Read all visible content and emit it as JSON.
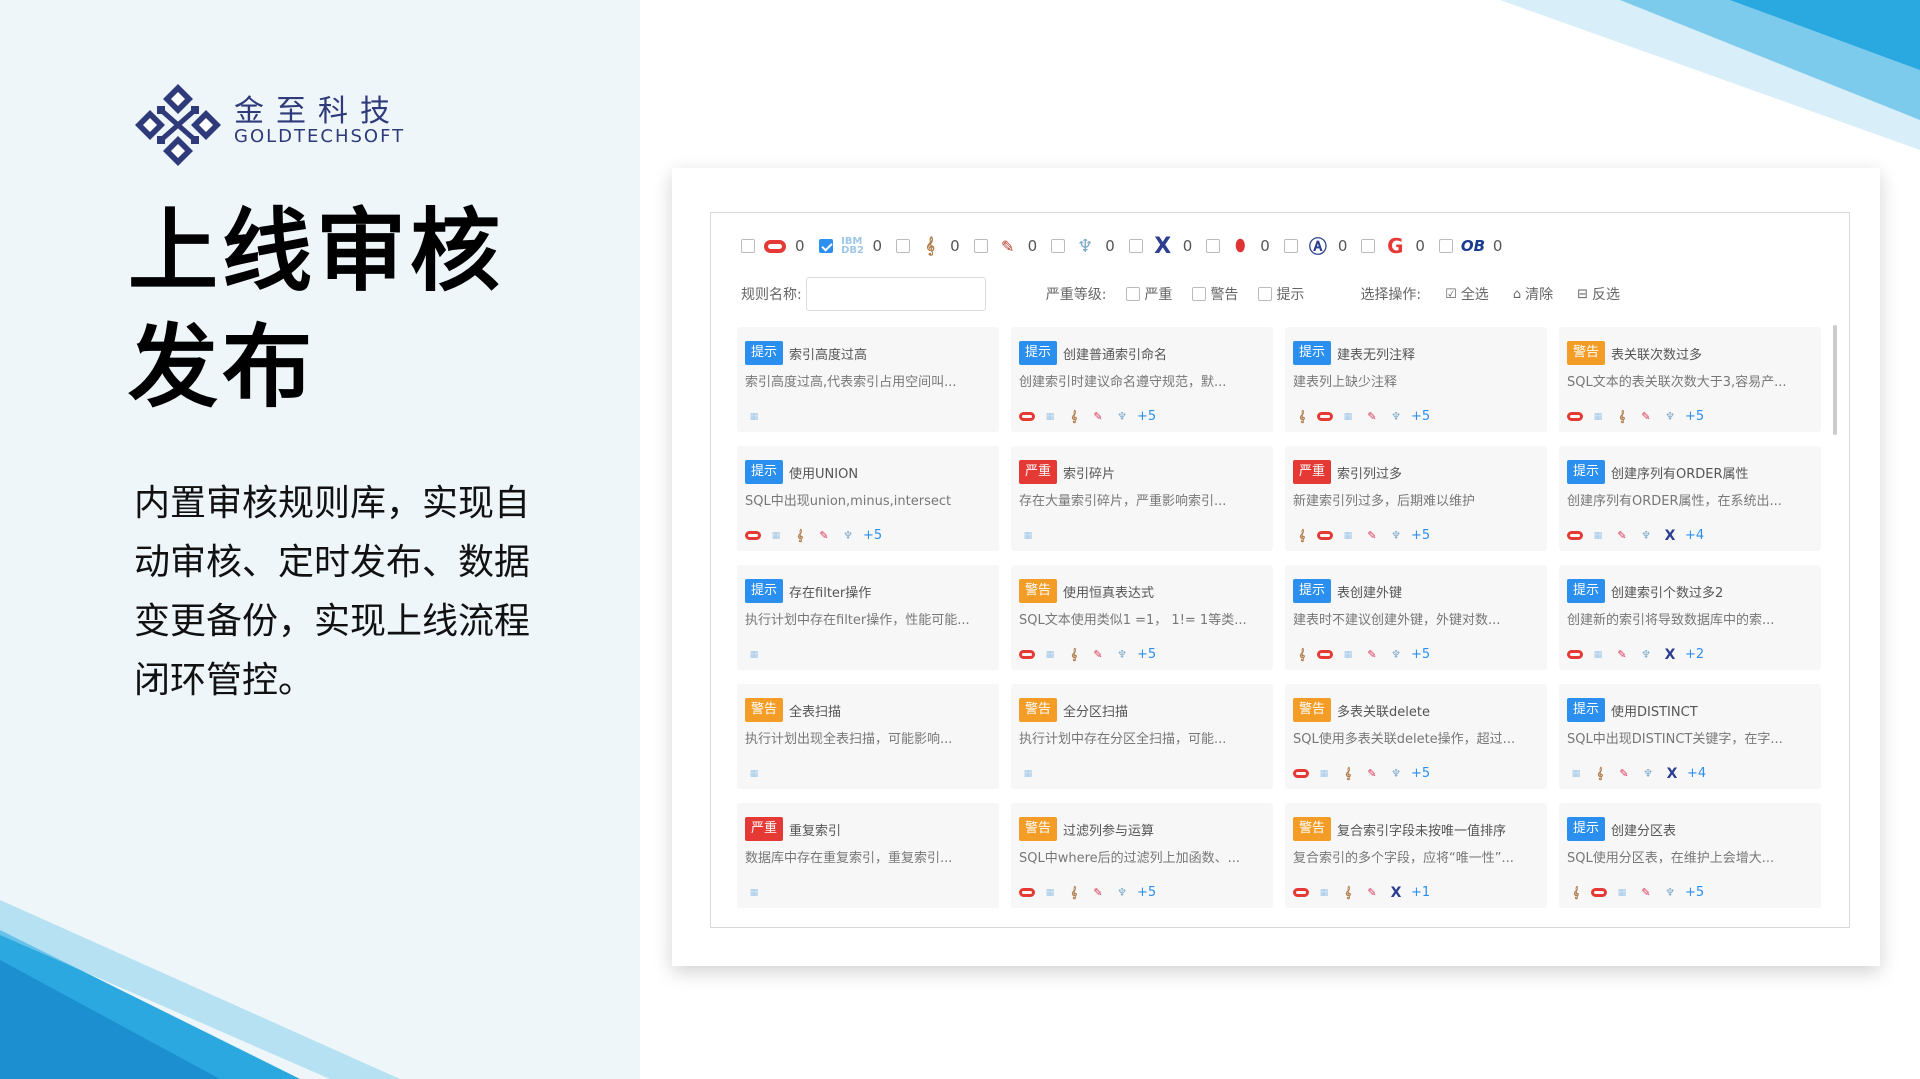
{
  "brand": {
    "name_cn": "金至科技",
    "name_en": "GOLDTECHSOFT",
    "color": "#2f3a7a"
  },
  "title_lines": [
    "上线审核",
    "发布"
  ],
  "description": "内置审核规则库，实现自动审核、定时发布、数据变更备份，实现上线流程闭环管控。",
  "accent_colors": {
    "blue": "#2b8ff0",
    "orange": "#f39c26",
    "red": "#e53935",
    "deco": "#29a9e0"
  },
  "db_filters": [
    {
      "icon": "oracle-icon",
      "count": "0",
      "checked": false
    },
    {
      "icon": "db2-icon",
      "count": "0",
      "checked": true
    },
    {
      "icon": "mysql-icon",
      "count": "0",
      "checked": false
    },
    {
      "icon": "mariadb-icon",
      "count": "0",
      "checked": false
    },
    {
      "icon": "postgresql-icon",
      "count": "0",
      "checked": false
    },
    {
      "icon": "x-db-icon",
      "count": "0",
      "checked": false
    },
    {
      "icon": "redis-icon",
      "count": "0",
      "checked": false
    },
    {
      "icon": "arrow-db-icon",
      "count": "0",
      "checked": false
    },
    {
      "icon": "g-db-icon",
      "count": "0",
      "checked": false
    },
    {
      "icon": "oceanbase-icon",
      "count": "0",
      "checked": false
    }
  ],
  "filters": {
    "rule_name_label": "规则名称:",
    "severity_label": "严重等级:",
    "severity_options": [
      "严重",
      "警告",
      "提示"
    ],
    "ops_label": "选择操作:",
    "ops": [
      {
        "icon": "check-all-icon",
        "label": "全选"
      },
      {
        "icon": "clear-icon",
        "label": "清除"
      },
      {
        "icon": "invert-icon",
        "label": "反选"
      }
    ]
  },
  "rules": [
    {
      "level": "提示",
      "kind": "tip",
      "name": "索引高度过高",
      "desc": "索引高度过高,代表索引占用空间叫...",
      "dbs": [
        "db2"
      ],
      "extra": ""
    },
    {
      "level": "提示",
      "kind": "tip",
      "name": "创建普通索引命名",
      "desc": "创建索引时建议命名遵守规范，默...",
      "dbs": [
        "oracle",
        "db2",
        "mysql",
        "mongo",
        "pg"
      ],
      "extra": "+5"
    },
    {
      "level": "提示",
      "kind": "tip",
      "name": "建表无列注释",
      "desc": "建表列上缺少注释",
      "dbs": [
        "mysql",
        "oracle",
        "db2",
        "mongo",
        "pg"
      ],
      "extra": "+5"
    },
    {
      "level": "警告",
      "kind": "warn",
      "name": "表关联次数过多",
      "desc": "SQL文本的表关联次数大于3,容易产...",
      "dbs": [
        "oracle",
        "db2",
        "mysql",
        "mongo",
        "pg"
      ],
      "extra": "+5"
    },
    {
      "level": "提示",
      "kind": "tip",
      "name": "使用UNION",
      "desc": "SQL中出现union,minus,intersect",
      "dbs": [
        "oracle",
        "db2",
        "mysql",
        "mongo",
        "pg"
      ],
      "extra": "+5"
    },
    {
      "level": "严重",
      "kind": "severe",
      "name": "索引碎片",
      "desc": "存在大量索引碎片，严重影响索引...",
      "dbs": [
        "db2"
      ],
      "extra": ""
    },
    {
      "level": "严重",
      "kind": "severe",
      "name": "索引列过多",
      "desc": "新建索引列过多，后期难以维护",
      "dbs": [
        "mysql",
        "oracle",
        "db2",
        "mongo",
        "pg"
      ],
      "extra": "+5"
    },
    {
      "level": "提示",
      "kind": "tip",
      "name": "创建序列有ORDER属性",
      "desc": "创建序列有ORDER属性，在系统出...",
      "dbs": [
        "oracle",
        "db2",
        "mongo",
        "pg",
        "x"
      ],
      "extra": "+4"
    },
    {
      "level": "提示",
      "kind": "tip",
      "name": "存在filter操作",
      "desc": "执行计划中存在filter操作，性能可能...",
      "dbs": [
        "db2"
      ],
      "extra": ""
    },
    {
      "level": "警告",
      "kind": "warn",
      "name": "使用恒真表达式",
      "desc": "SQL文本使用类似1 =1， 1!= 1等类...",
      "dbs": [
        "oracle",
        "db2",
        "mysql",
        "mongo",
        "pg"
      ],
      "extra": "+5"
    },
    {
      "level": "提示",
      "kind": "tip",
      "name": "表创建外键",
      "desc": "建表时不建议创建外键，外键对数...",
      "dbs": [
        "mysql",
        "oracle",
        "db2",
        "mongo",
        "pg"
      ],
      "extra": "+5"
    },
    {
      "level": "提示",
      "kind": "tip",
      "name": "创建索引个数过多2",
      "desc": "创建新的索引将导致数据库中的索...",
      "dbs": [
        "oracle",
        "db2",
        "mongo",
        "pg",
        "x"
      ],
      "extra": "+2"
    },
    {
      "level": "警告",
      "kind": "warn",
      "name": "全表扫描",
      "desc": "执行计划出现全表扫描，可能影响...",
      "dbs": [
        "db2"
      ],
      "extra": ""
    },
    {
      "level": "警告",
      "kind": "warn",
      "name": "全分区扫描",
      "desc": "执行计划中存在分区全扫描，可能...",
      "dbs": [
        "db2"
      ],
      "extra": ""
    },
    {
      "level": "警告",
      "kind": "warn",
      "name": "多表关联delete",
      "desc": "SQL使用多表关联delete操作，超过...",
      "dbs": [
        "oracle",
        "db2",
        "mysql",
        "mongo",
        "pg"
      ],
      "extra": "+5"
    },
    {
      "level": "提示",
      "kind": "tip",
      "name": "使用DISTINCT",
      "desc": "SQL中出现DISTINCT关键字，在字...",
      "dbs": [
        "db2",
        "mysql",
        "mongo",
        "pg",
        "x"
      ],
      "extra": "+4"
    },
    {
      "level": "严重",
      "kind": "severe",
      "name": "重复索引",
      "desc": "数据库中存在重复索引，重复索引...",
      "dbs": [
        "db2"
      ],
      "extra": ""
    },
    {
      "level": "警告",
      "kind": "warn",
      "name": "过滤列参与运算",
      "desc": "SQL中where后的过滤列上加函数、...",
      "dbs": [
        "oracle",
        "db2",
        "mysql",
        "mongo",
        "pg"
      ],
      "extra": "+5"
    },
    {
      "level": "警告",
      "kind": "warn",
      "name": "复合索引字段未按唯一值排序",
      "desc": "复合索引的多个字段，应将“唯一性”...",
      "dbs": [
        "oracle",
        "db2",
        "mysql",
        "mongo",
        "x"
      ],
      "extra": "+1"
    },
    {
      "level": "提示",
      "kind": "tip",
      "name": "创建分区表",
      "desc": "SQL使用分区表，在维护上会增大...",
      "dbs": [
        "mysql",
        "oracle",
        "db2",
        "mongo",
        "pg"
      ],
      "extra": "+5"
    }
  ]
}
